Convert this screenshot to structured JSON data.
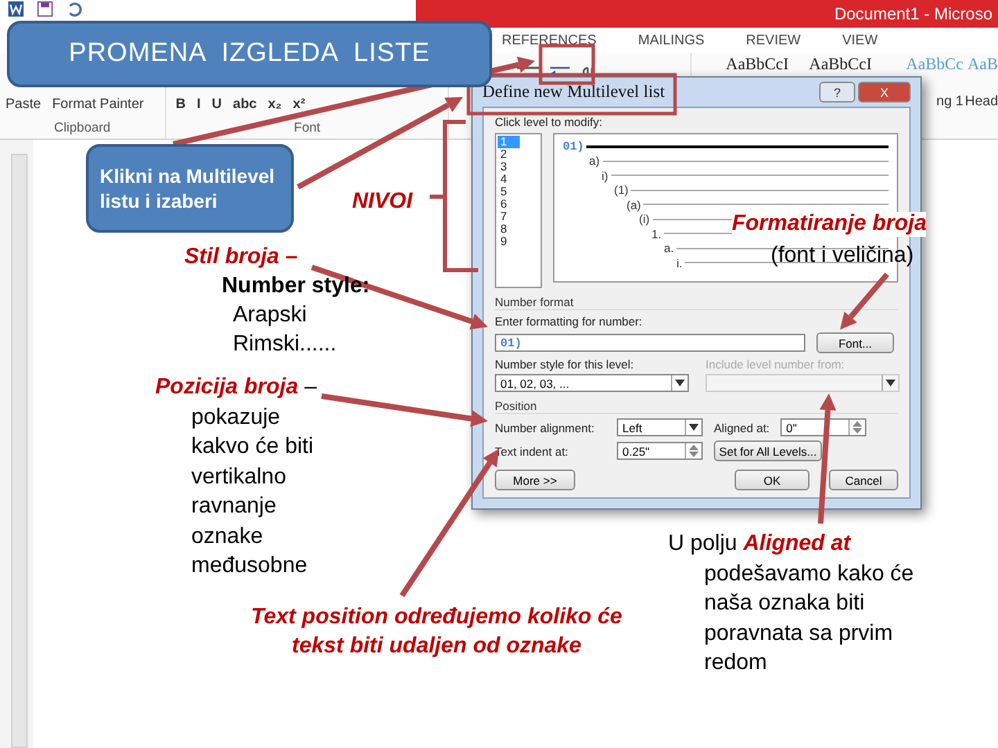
{
  "app": {
    "document_title": "Document1 - Microso",
    "tabs": [
      "REFERENCES",
      "MAILINGS",
      "REVIEW",
      "VIEW"
    ],
    "clipboard": {
      "paste": "Paste",
      "format_painter": "Format Painter",
      "label": "Clipboard"
    },
    "font_group": {
      "buttons": [
        "B",
        "I",
        "U",
        "abc",
        "x₂",
        "x²"
      ],
      "label": "Font"
    },
    "styles": [
      {
        "sample": "AaBbCcI"
      },
      {
        "sample": "AaBbCcI"
      },
      {
        "sample": "AaBbCc",
        "name": "ng 1"
      },
      {
        "sample": "AaB",
        "name": "Head"
      }
    ]
  },
  "dialog": {
    "title": "Define new Multilevel list",
    "help": "?",
    "close": "X",
    "level_label": "Click level to modify:",
    "levels": [
      {
        "label": "1",
        "selected": true
      },
      {
        "label": "2",
        "selected": false
      },
      {
        "label": "3",
        "selected": false
      },
      {
        "label": "4",
        "selected": false
      },
      {
        "label": "5",
        "selected": false
      },
      {
        "label": "6",
        "selected": false
      },
      {
        "label": "7",
        "selected": false
      },
      {
        "label": "8",
        "selected": false
      },
      {
        "label": "9",
        "selected": false
      }
    ],
    "preview": [
      "01)",
      "a)",
      "i)",
      "(1)",
      "(a)",
      "(i)",
      "1.",
      "a.",
      "i."
    ],
    "number_format": "Number format",
    "format_label": "Enter formatting for number:",
    "format_value": "01)",
    "font_button": "Font...",
    "style_label": "Number style for this level:",
    "style_value": "01, 02, 03, ...",
    "include_label": "Include level number from:",
    "include_disabled": true,
    "position": "Position",
    "alignment_label": "Number alignment:",
    "alignment_value": "Left",
    "aligned_label": "Aligned at:",
    "aligned_value": "0\"",
    "indent_label": "Text indent at:",
    "indent_value": "0.25\"",
    "set_all": "Set for All Levels...",
    "more": "More >>",
    "ok": "OK",
    "cancel": "Cancel"
  },
  "annotations": {
    "title": "PROMENA  IZGLEDA  LISTE",
    "click_note": "Klikni na Multilevel listu i izaberi",
    "levels_note": "NIVOI",
    "format_note": {
      "title": "Formatiranje broja",
      "text": "(font i veličina)"
    },
    "style_note": {
      "label": "Stil broja –",
      "heading": "Number style:",
      "items": [
        "Arapski",
        "Rimski......"
      ]
    },
    "position_note": "**Pozicija broja** – pokazuje kakvo će biti vertikalno ravnanje oznake međusobne",
    "indent_note": "Text position određujemo koliko će tekst biti udaljen od oznake",
    "aligned_note": "U polju **Aligned at** podešavamo kako će naša oznaka biti poravnata sa prvim redom"
  }
}
